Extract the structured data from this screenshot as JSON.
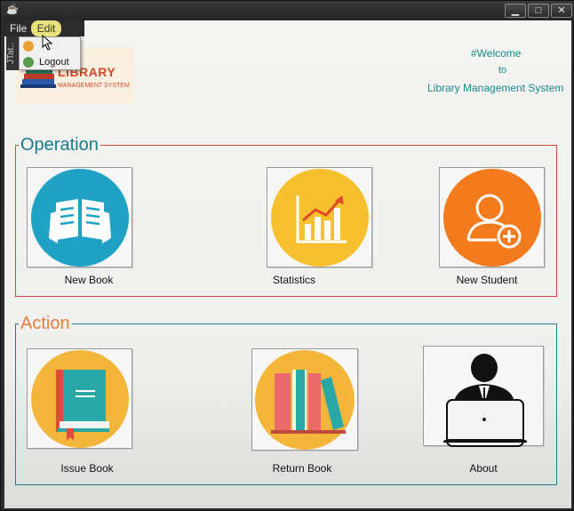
{
  "menubar": {
    "file_label": "File",
    "edit_label": "Edit"
  },
  "side_tab": {
    "label": "JTat.."
  },
  "dropdown": {
    "items": [
      {
        "label": ""
      },
      {
        "label": "Logout"
      }
    ]
  },
  "logo": {
    "line1": "LIBRARY",
    "line2": "MANAGEMENT SYSTEM"
  },
  "welcome": {
    "line1": "#Welcome",
    "line2": "to",
    "line3": "Library Management System"
  },
  "operation": {
    "title": "Operation",
    "tiles": [
      {
        "label": "New Book",
        "icon": "book-reading-icon",
        "color": "#1fa2c4"
      },
      {
        "label": "Statistics",
        "icon": "bar-chart-icon",
        "color": "#f7c02e"
      },
      {
        "label": "New Student",
        "icon": "add-user-icon",
        "color": "#f47b1d"
      }
    ]
  },
  "action": {
    "title": "Action",
    "tiles": [
      {
        "label": "Issue Book",
        "icon": "closed-book-icon",
        "color": "#f4b63a"
      },
      {
        "label": "Return Book",
        "icon": "books-stack-icon",
        "color": "#f4b63a"
      },
      {
        "label": "About",
        "icon": "person-laptop-icon",
        "color": "#111111"
      }
    ]
  },
  "colors": {
    "operation_border": "#d24a3a",
    "action_border": "#2a7a8a",
    "operation_title": "#1a7a8a",
    "action_title": "#f07a3a"
  }
}
